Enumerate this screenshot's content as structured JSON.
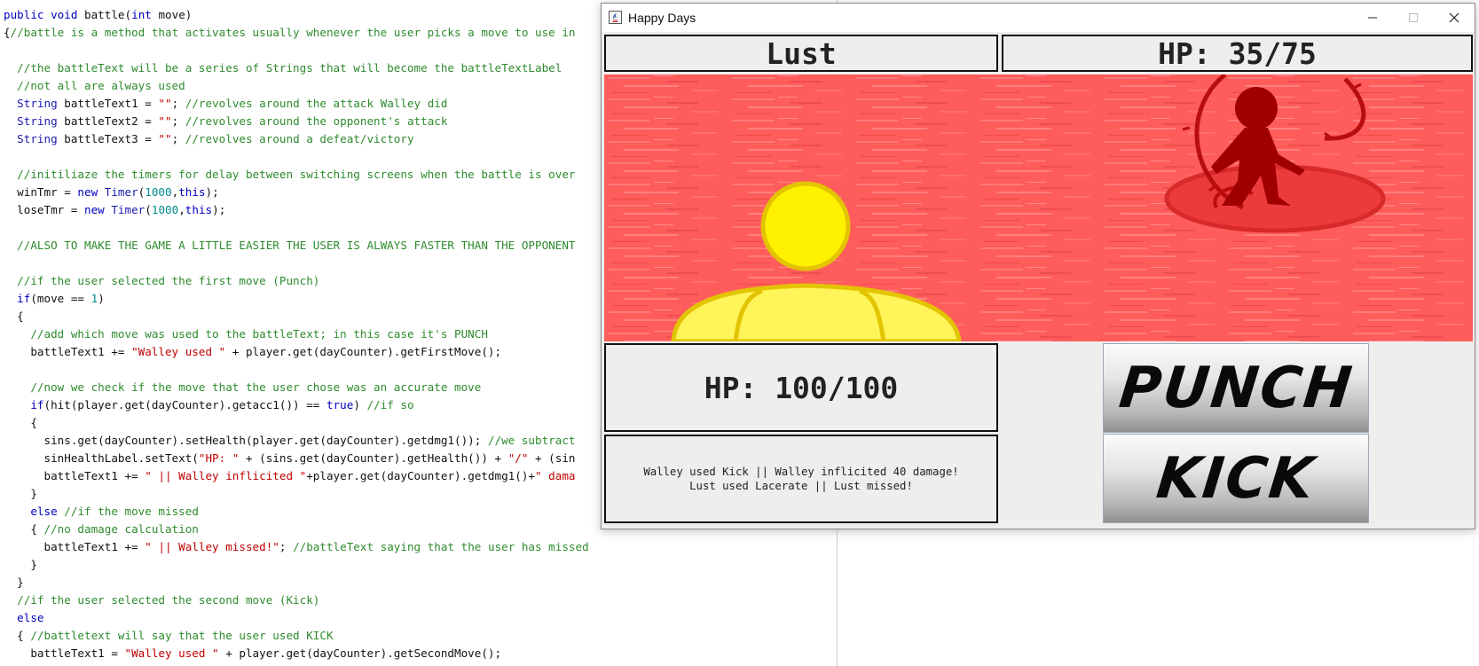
{
  "editor": {
    "lines": [
      [
        {
          "t": "kw",
          "v": "public"
        },
        {
          "t": "tx",
          "v": " "
        },
        {
          "t": "kw",
          "v": "void"
        },
        {
          "t": "tx",
          "v": " battle("
        },
        {
          "t": "kw",
          "v": "int"
        },
        {
          "t": "tx",
          "v": " move)"
        }
      ],
      [
        {
          "t": "tx",
          "v": "{"
        },
        {
          "t": "cm",
          "v": "//battle is a method that activates usually whenever the user picks a move to use in"
        }
      ],
      [],
      [
        {
          "t": "tx",
          "v": "  "
        },
        {
          "t": "cm",
          "v": "//the battleText will be a series of Strings that will become the battleTextLabel"
        }
      ],
      [
        {
          "t": "tx",
          "v": "  "
        },
        {
          "t": "cm",
          "v": "//not all are always used"
        }
      ],
      [
        {
          "t": "tx",
          "v": "  "
        },
        {
          "t": "type",
          "v": "String"
        },
        {
          "t": "tx",
          "v": " battleText1 = "
        },
        {
          "t": "str",
          "v": "\"\""
        },
        {
          "t": "tx",
          "v": "; "
        },
        {
          "t": "cm",
          "v": "//revolves around the attack Walley did"
        }
      ],
      [
        {
          "t": "tx",
          "v": "  "
        },
        {
          "t": "type",
          "v": "String"
        },
        {
          "t": "tx",
          "v": " battleText2 = "
        },
        {
          "t": "str",
          "v": "\"\""
        },
        {
          "t": "tx",
          "v": "; "
        },
        {
          "t": "cm",
          "v": "//revolves around the opponent's attack"
        }
      ],
      [
        {
          "t": "tx",
          "v": "  "
        },
        {
          "t": "type",
          "v": "String"
        },
        {
          "t": "tx",
          "v": " battleText3 = "
        },
        {
          "t": "str",
          "v": "\"\""
        },
        {
          "t": "tx",
          "v": "; "
        },
        {
          "t": "cm",
          "v": "//revolves around a defeat/victory"
        }
      ],
      [],
      [
        {
          "t": "tx",
          "v": "  "
        },
        {
          "t": "cm",
          "v": "//initiliaze the timers for delay between switching screens when the battle is over"
        }
      ],
      [
        {
          "t": "tx",
          "v": "  winTmr = "
        },
        {
          "t": "kw",
          "v": "new"
        },
        {
          "t": "tx",
          "v": " "
        },
        {
          "t": "type",
          "v": "Timer"
        },
        {
          "t": "tx",
          "v": "("
        },
        {
          "t": "num",
          "v": "1000"
        },
        {
          "t": "tx",
          "v": ","
        },
        {
          "t": "kw",
          "v": "this"
        },
        {
          "t": "tx",
          "v": ");"
        }
      ],
      [
        {
          "t": "tx",
          "v": "  loseTmr = "
        },
        {
          "t": "kw",
          "v": "new"
        },
        {
          "t": "tx",
          "v": " "
        },
        {
          "t": "type",
          "v": "Timer"
        },
        {
          "t": "tx",
          "v": "("
        },
        {
          "t": "num",
          "v": "1000"
        },
        {
          "t": "tx",
          "v": ","
        },
        {
          "t": "kw",
          "v": "this"
        },
        {
          "t": "tx",
          "v": ");"
        }
      ],
      [],
      [
        {
          "t": "tx",
          "v": "  "
        },
        {
          "t": "cm",
          "v": "//ALSO TO MAKE THE GAME A LITTLE EASIER THE USER IS ALWAYS FASTER THAN THE OPPONENT"
        }
      ],
      [],
      [
        {
          "t": "tx",
          "v": "  "
        },
        {
          "t": "cm",
          "v": "//if the user selected the first move (Punch)"
        }
      ],
      [
        {
          "t": "tx",
          "v": "  "
        },
        {
          "t": "kw",
          "v": "if"
        },
        {
          "t": "tx",
          "v": "(move == "
        },
        {
          "t": "num",
          "v": "1"
        },
        {
          "t": "tx",
          "v": ")"
        }
      ],
      [
        {
          "t": "tx",
          "v": "  {"
        }
      ],
      [
        {
          "t": "tx",
          "v": "    "
        },
        {
          "t": "cm",
          "v": "//add which move was used to the battleText; in this case it's PUNCH"
        }
      ],
      [
        {
          "t": "tx",
          "v": "    battleText1 += "
        },
        {
          "t": "str",
          "v": "\"Walley used \""
        },
        {
          "t": "tx",
          "v": " + player.get(dayCounter).getFirstMove();"
        }
      ],
      [],
      [
        {
          "t": "tx",
          "v": "    "
        },
        {
          "t": "cm",
          "v": "//now we check if the move that the user chose was an accurate move"
        }
      ],
      [
        {
          "t": "tx",
          "v": "    "
        },
        {
          "t": "kw",
          "v": "if"
        },
        {
          "t": "tx",
          "v": "(hit(player.get(dayCounter).getacc1()) == "
        },
        {
          "t": "kw",
          "v": "true"
        },
        {
          "t": "tx",
          "v": ") "
        },
        {
          "t": "cm",
          "v": "//if so"
        }
      ],
      [
        {
          "t": "tx",
          "v": "    {"
        }
      ],
      [
        {
          "t": "tx",
          "v": "      sins.get(dayCounter).setHealth(player.get(dayCounter).getdmg1()); "
        },
        {
          "t": "cm",
          "v": "//we subtract"
        }
      ],
      [
        {
          "t": "tx",
          "v": "      sinHealthLabel.setText("
        },
        {
          "t": "str",
          "v": "\"HP: \""
        },
        {
          "t": "tx",
          "v": " + (sins.get(dayCounter).getHealth()) + "
        },
        {
          "t": "str",
          "v": "\"/\""
        },
        {
          "t": "tx",
          "v": " + (sin"
        }
      ],
      [
        {
          "t": "tx",
          "v": "      battleText1 += "
        },
        {
          "t": "str",
          "v": "\" || Walley inflicited \""
        },
        {
          "t": "tx",
          "v": "+player.get(dayCounter).getdmg1()+"
        },
        {
          "t": "str",
          "v": "\" dama"
        }
      ],
      [
        {
          "t": "tx",
          "v": "    }"
        }
      ],
      [
        {
          "t": "tx",
          "v": "    "
        },
        {
          "t": "kw",
          "v": "else"
        },
        {
          "t": "tx",
          "v": " "
        },
        {
          "t": "cm",
          "v": "//if the move missed"
        }
      ],
      [
        {
          "t": "tx",
          "v": "    { "
        },
        {
          "t": "cm",
          "v": "//no damage calculation"
        }
      ],
      [
        {
          "t": "tx",
          "v": "      battleText1 += "
        },
        {
          "t": "str",
          "v": "\" || Walley missed!\""
        },
        {
          "t": "tx",
          "v": "; "
        },
        {
          "t": "cm",
          "v": "//battleText saying that the user has missed"
        }
      ],
      [
        {
          "t": "tx",
          "v": "    }"
        }
      ],
      [
        {
          "t": "tx",
          "v": "  }"
        }
      ],
      [
        {
          "t": "tx",
          "v": "  "
        },
        {
          "t": "cm",
          "v": "//if the user selected the second move (Kick)"
        }
      ],
      [
        {
          "t": "tx",
          "v": "  "
        },
        {
          "t": "kw",
          "v": "else"
        }
      ],
      [
        {
          "t": "tx",
          "v": "  { "
        },
        {
          "t": "cm",
          "v": "//battletext will say that the user used KICK"
        }
      ],
      [
        {
          "t": "tx",
          "v": "    battleText1 = "
        },
        {
          "t": "str",
          "v": "\"Walley used \""
        },
        {
          "t": "tx",
          "v": " + player.get(dayCounter).getSecondMove();"
        }
      ]
    ]
  },
  "window": {
    "title": "Happy Days",
    "minimize_icon": "minimize-icon",
    "maximize_icon": "maximize-icon",
    "close_icon": "close-icon"
  },
  "battle": {
    "enemy_name": "Lust",
    "enemy_hp": "HP: 35/75",
    "player_hp": "HP: 100/100",
    "log": [
      "Walley used Kick || Walley inflicited 40 damage!",
      "Lust used Lacerate || Lust missed!"
    ],
    "moves": {
      "punch_label": "PUNCH",
      "kick_label": "KICK"
    }
  },
  "colors": {
    "arena_bg": "#ff5a5a",
    "player": "#ffee00",
    "player_outline": "#e3c400",
    "enemy": "#a00000",
    "enemy_ring": "#e83a3a"
  }
}
